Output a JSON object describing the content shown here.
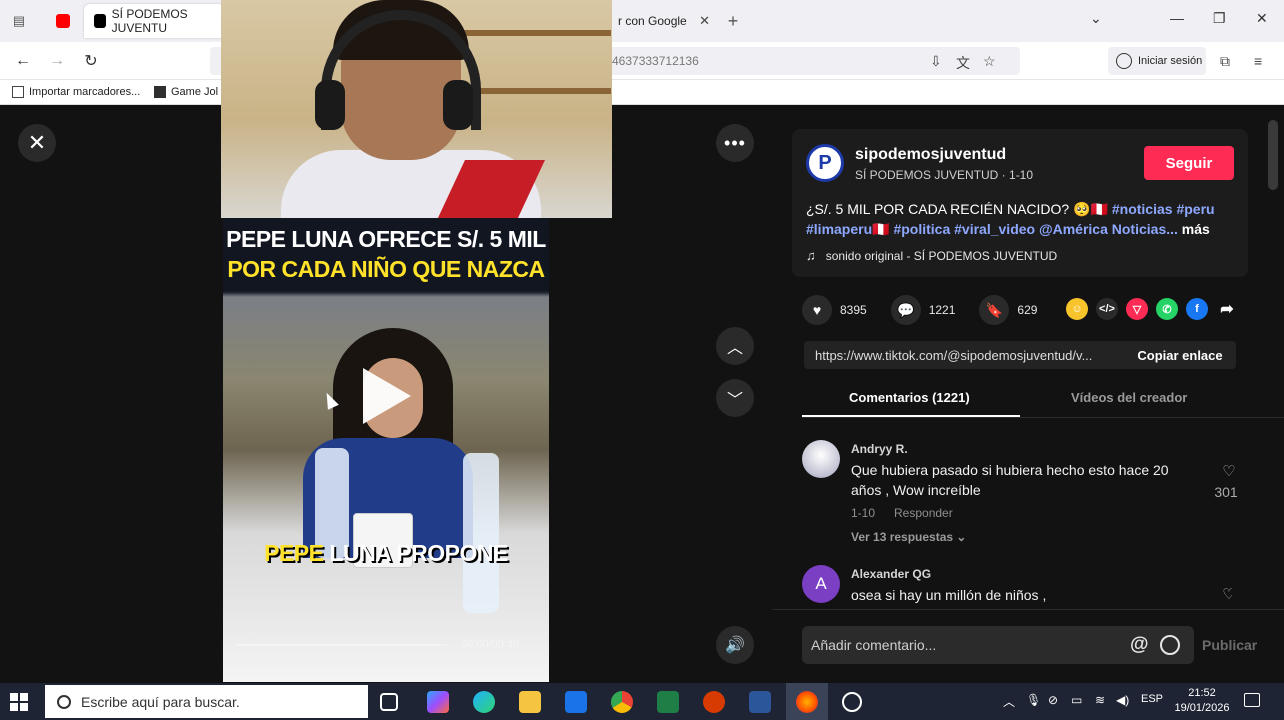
{
  "browser": {
    "tabs": [
      {
        "label": "",
        "favicon_color": "#ff0000"
      },
      {
        "label": "SÍ PODEMOS JUVENTU",
        "favicon_color": "#000000"
      },
      {
        "label": "r con Google"
      }
    ],
    "tab_close": "✕",
    "new_tab": "+",
    "url": "4637333712136",
    "sign_in": "Iniciar sesión",
    "bookmarks": [
      {
        "label": "Importar marcadores..."
      },
      {
        "label": "Game Jol"
      }
    ]
  },
  "player": {
    "headline_line1": "PEPE LUNA OFRECE S/. 5 MIL",
    "headline_line2": "POR CADA NIÑO QUE NAZCA",
    "overlay_word1": "PEPE",
    "overlay_word2": "LUNA PROPONE",
    "timecode": "00:00/00:38",
    "progress": 0.0
  },
  "post": {
    "username": "sipodemosjuventud",
    "display_name": "SÍ PODEMOS JUVENTUD · 1-10",
    "follow_label": "Seguir",
    "desc_plain1": "¿S/. 5 MIL POR CADA RECIÉN NACIDO? 🥺🇵🇪 ",
    "desc_tags1": "#noticias #peru",
    "desc_tags2": "#limaperu🇵🇪 #politica #viral_video @América Noticias...",
    "desc_more": "más",
    "sound": "sonido original - SÍ PODEMOS JUVENTUD",
    "likes": "8395",
    "comments": "1221",
    "saves": "629",
    "share_link": "https://www.tiktok.com/@sipodemosjuventud/v...",
    "copy_label": "Copiar enlace",
    "tab_comments": "Comentarios (1221)",
    "tab_creator": "Vídeos del creador"
  },
  "comments_list": [
    {
      "user": "Andryy R.",
      "text": "Que hubiera pasado si hubiera hecho esto hace 20 años , Wow increíble",
      "date": "1-10",
      "reply_label": "Responder",
      "replies": "Ver 13 respuestas ⌄",
      "likes": "301"
    },
    {
      "user": "Alexander QG",
      "avatar_letter": "A",
      "text": "osea si hay un millón de niños ,"
    }
  ],
  "add_comment": {
    "placeholder": "Añadir comentario...",
    "at": "@",
    "post_label": "Publicar"
  },
  "taskbar": {
    "search_placeholder": "Escribe aquí para buscar.",
    "language": "ESP",
    "time": "21:52",
    "date": "19/01/2026"
  },
  "colors": {
    "accent_follow": "#fe2c55",
    "hashtag": "#8ea8ff",
    "headline_yellow": "#ffe229"
  }
}
